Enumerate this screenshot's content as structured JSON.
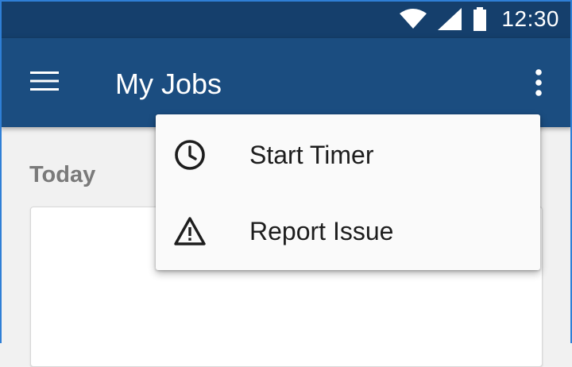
{
  "status_bar": {
    "time": "12:30",
    "icons": [
      "wifi-icon",
      "signal-icon",
      "battery-icon"
    ],
    "background": "#153f6c"
  },
  "app_bar": {
    "title": "My Jobs",
    "menu_icon": "hamburger-menu-icon",
    "overflow_icon": "more-vertical-icon",
    "background": "#1b4d80"
  },
  "content": {
    "section_title": "Today"
  },
  "overflow_menu": {
    "items": [
      {
        "label": "Start Timer",
        "icon": "clock-icon"
      },
      {
        "label": "Report Issue",
        "icon": "warning-icon"
      }
    ]
  }
}
